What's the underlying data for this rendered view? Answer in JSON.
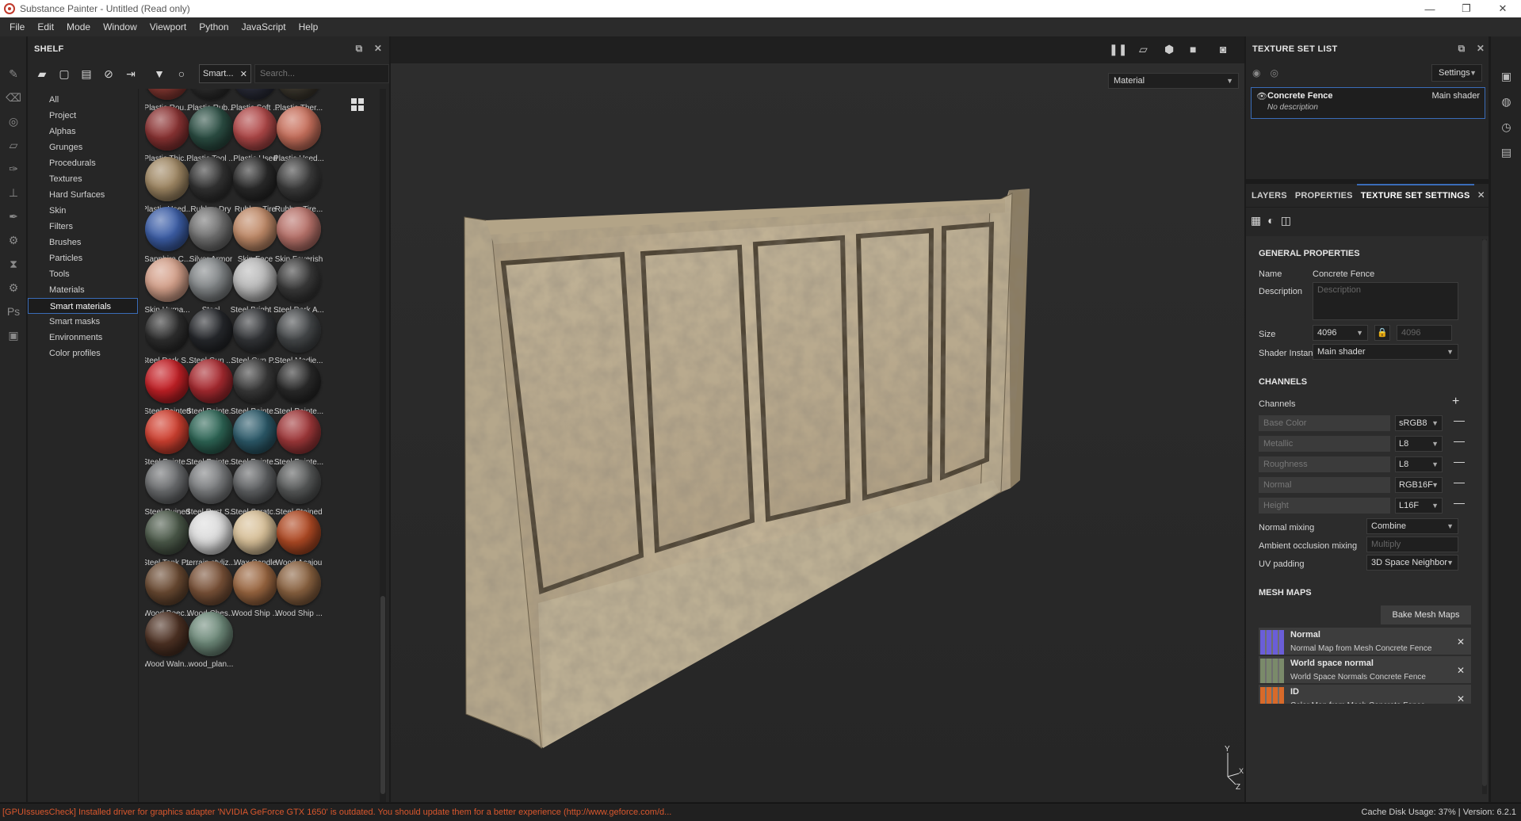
{
  "window": {
    "title": "Substance Painter - Untitled (Read only)",
    "controls": [
      "—",
      "❐",
      "✕"
    ]
  },
  "menu": [
    "File",
    "Edit",
    "Mode",
    "Window",
    "Viewport",
    "Python",
    "JavaScript",
    "Help"
  ],
  "tools": [
    "paint-brush-icon",
    "eraser-icon",
    "projection-icon",
    "polygon-fill-icon",
    "smudge-icon",
    "clone-stamp-icon",
    "color-picker-icon",
    "settings-icon",
    "display-icon",
    "properties-icon",
    "photoshop-icon",
    "screenshot-icon"
  ],
  "shelf": {
    "title": "SHELF",
    "filter_chip": "Smart...",
    "search_placeholder": "Search...",
    "categories": [
      "All",
      "Project",
      "Alphas",
      "Grunges",
      "Procedurals",
      "Textures",
      "Hard Surfaces",
      "Skin",
      "Filters",
      "Brushes",
      "Particles",
      "Tools",
      "Materials",
      "Smart materials",
      "Smart masks",
      "Environments",
      "Color profiles"
    ],
    "active_category": "Smart materials",
    "materials": [
      {
        "label": "Plastic Rou...",
        "color": "#8a3a34"
      },
      {
        "label": "Plastic Rub...",
        "color": "#2e2e2e"
      },
      {
        "label": "Plastic Soft ...",
        "color": "#2b2d3a"
      },
      {
        "label": "Plastic Ther...",
        "color": "#3f3a30"
      },
      {
        "label": "Plastic Thic...",
        "color": "#8c3434"
      },
      {
        "label": "Plastic Tool ...",
        "color": "#2c4f44"
      },
      {
        "label": "Plastic Used",
        "color": "#b04848"
      },
      {
        "label": "Plastic Used...",
        "color": "#c8705c"
      },
      {
        "label": "Plastic Used...",
        "color": "#a08864"
      },
      {
        "label": "Rubber Dry",
        "color": "#333333"
      },
      {
        "label": "Rubber Tire",
        "color": "#2a2a2a"
      },
      {
        "label": "Rubber Tire...",
        "color": "#3c3c3c"
      },
      {
        "label": "Sapphire C...",
        "color": "#3d5fa8"
      },
      {
        "label": "Silver Armor",
        "color": "#707070"
      },
      {
        "label": "Skin Face",
        "color": "#c08a68"
      },
      {
        "label": "Skin Feverish",
        "color": "#b8726a"
      },
      {
        "label": "Skin Huma...",
        "color": "#d4a08a"
      },
      {
        "label": "Steel",
        "color": "#808486"
      },
      {
        "label": "Steel Bright ...",
        "color": "#b8b8b8"
      },
      {
        "label": "Steel Dark A...",
        "color": "#3a3a3a"
      },
      {
        "label": "Steel Dark S...",
        "color": "#2e2e2e"
      },
      {
        "label": "Steel Gun ...",
        "color": "#26282c"
      },
      {
        "label": "Steel Gun P...",
        "color": "#333538"
      },
      {
        "label": "Steel Medie...",
        "color": "#45484a"
      },
      {
        "label": "Steel Painted",
        "color": "#c42026"
      },
      {
        "label": "Steel Painte...",
        "color": "#a82a30"
      },
      {
        "label": "Steel Painte...",
        "color": "#3a3a3a"
      },
      {
        "label": "Steel Painte...",
        "color": "#2a2a2a"
      },
      {
        "label": "Steel Painte...",
        "color": "#d04030"
      },
      {
        "label": "Steel Painte...",
        "color": "#2e6656"
      },
      {
        "label": "Steel Painte...",
        "color": "#2c5a6a"
      },
      {
        "label": "Steel Painte...",
        "color": "#a0383a"
      },
      {
        "label": "Steel Ruined",
        "color": "#6a6c6e"
      },
      {
        "label": "Steel Rust S...",
        "color": "#7a7c7e"
      },
      {
        "label": "Steel Scratc...",
        "color": "#5e6062"
      },
      {
        "label": "Steel Stained",
        "color": "#565858"
      },
      {
        "label": "Steel Tank P...",
        "color": "#4c5a4a"
      },
      {
        "label": "terrain styliz...",
        "color": "#dcdcdc"
      },
      {
        "label": "Wax Candle",
        "color": "#d8c098"
      },
      {
        "label": "Wood Acajou",
        "color": "#b04a24"
      },
      {
        "label": "Wood Beec...",
        "color": "#6a4a32"
      },
      {
        "label": "Wood Ches...",
        "color": "#7a5238"
      },
      {
        "label": "Wood Ship ...",
        "color": "#9a6640"
      },
      {
        "label": "Wood Ship ...",
        "color": "#8a6240"
      },
      {
        "label": "Wood Waln...",
        "color": "#4e3224"
      },
      {
        "label": "wood_plan...",
        "color": "#6e8a7a"
      }
    ]
  },
  "viewport": {
    "channel_select": "Material",
    "toolbar_icons": [
      "pause-icon",
      "perspective-icon",
      "cube-icon",
      "camera-icon",
      "screenshot-icon"
    ],
    "axis": {
      "y": "Y",
      "x": "X",
      "z": "Z"
    }
  },
  "texture_set_list": {
    "title": "TEXTURE SET LIST",
    "settings_label": "Settings",
    "item": {
      "name": "Concrete Fence",
      "shader": "Main shader",
      "description": "No description"
    }
  },
  "texture_settings": {
    "tabs": [
      "LAYERS",
      "PROPERTIES",
      "TEXTURE SET SETTINGS"
    ],
    "active_tab": "TEXTURE SET SETTINGS",
    "general_title": "GENERAL PROPERTIES",
    "name_label": "Name",
    "name_value": "Concrete Fence",
    "description_label": "Description",
    "description_placeholder": "Description",
    "size_label": "Size",
    "size_value": "4096",
    "size_value2": "4096",
    "shader_instance_label": "Shader Instance",
    "shader_instance_value": "Main shader",
    "channels_title": "CHANNELS",
    "channels_label": "Channels",
    "channels": [
      {
        "name": "Base Color",
        "format": "sRGB8"
      },
      {
        "name": "Metallic",
        "format": "L8"
      },
      {
        "name": "Roughness",
        "format": "L8"
      },
      {
        "name": "Normal",
        "format": "RGB16F"
      },
      {
        "name": "Height",
        "format": "L16F"
      }
    ],
    "normal_mixing_label": "Normal mixing",
    "normal_mixing_value": "Combine",
    "ao_mixing_label": "Ambient occlusion mixing",
    "ao_mixing_value": "Multiply",
    "uv_padding_label": "UV padding",
    "uv_padding_value": "3D Space Neighbor",
    "mesh_maps_title": "MESH MAPS",
    "bake_label": "Bake Mesh Maps",
    "mesh_maps": [
      {
        "name": "Normal",
        "desc": "Normal Map from Mesh Concrete Fence",
        "color": "#6a5ed8"
      },
      {
        "name": "World space normal",
        "desc": "World Space Normals Concrete Fence",
        "color": "#7a8a6a"
      },
      {
        "name": "ID",
        "desc": "Color Map from Mesh Concrete Fence",
        "color": "#d86a2a"
      }
    ]
  },
  "status": {
    "message": "[GPUIssuesCheck] Installed driver for graphics adapter 'NVIDIA GeForce GTX 1650' is outdated. You should update them for a better experience (http://www.geforce.com/d...",
    "cache": "Cache Disk Usage:   37% | Version: 6.2.1"
  }
}
